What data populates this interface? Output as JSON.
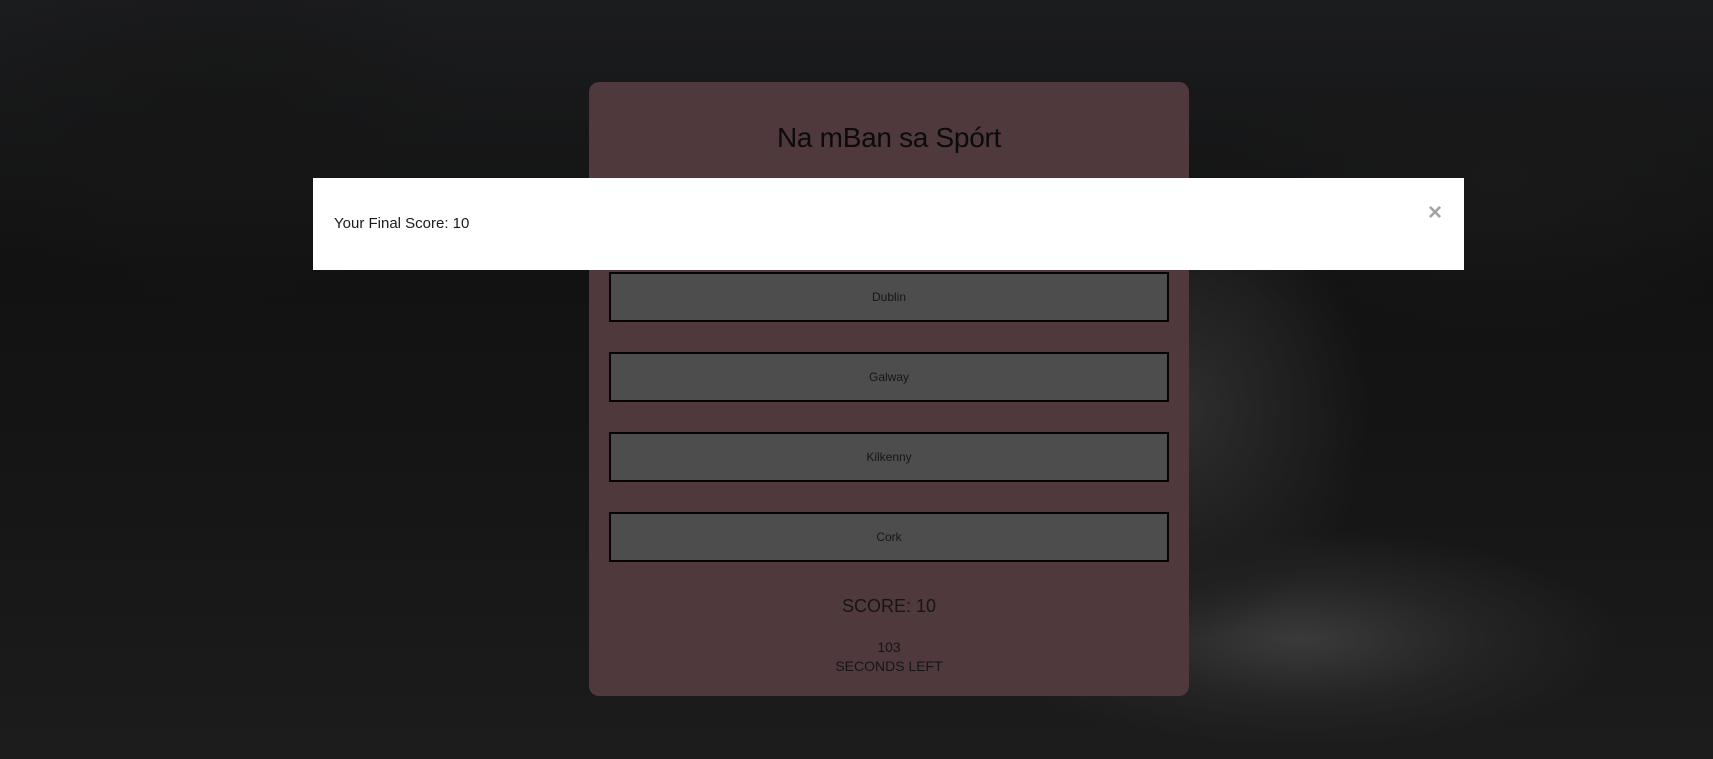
{
  "quiz": {
    "title": "Na mBan sa Spórt",
    "answers": [
      "Dublin",
      "Galway",
      "Kilkenny",
      "Cork"
    ],
    "score_label": "SCORE: 10",
    "time_value": "103",
    "time_label": "SECONDS LEFT"
  },
  "modal": {
    "message": "Your Final Score: 10",
    "close_symbol": "×"
  }
}
